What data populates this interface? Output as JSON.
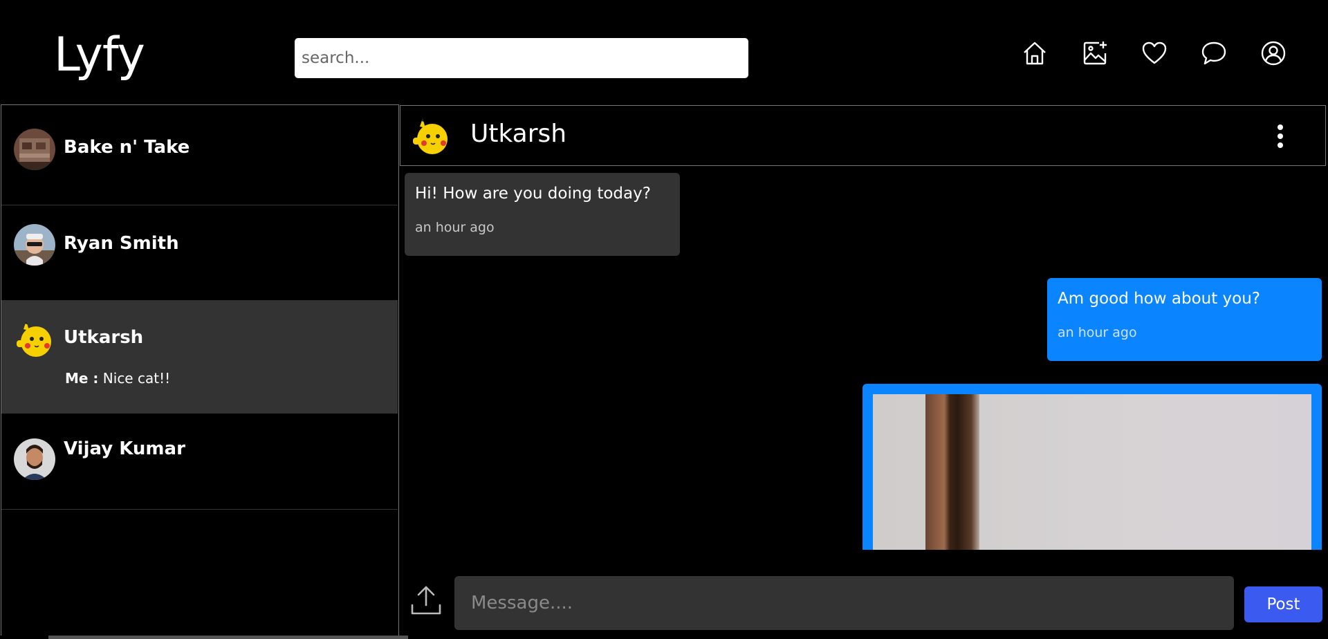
{
  "header": {
    "logo": "Lyfy",
    "search_placeholder": "search...",
    "nav_icons": [
      "home-icon",
      "add-photo-icon",
      "heart-icon",
      "chat-icon",
      "profile-icon"
    ]
  },
  "sidebar": {
    "contacts": [
      {
        "name": "Bake n' Take",
        "preview_sender": "",
        "preview_text": ""
      },
      {
        "name": "Ryan Smith",
        "preview_sender": "",
        "preview_text": ""
      },
      {
        "name": "Utkarsh",
        "preview_sender": "Me :",
        "preview_text": "Nice cat!!"
      },
      {
        "name": "Vijay Kumar",
        "preview_sender": "",
        "preview_text": ""
      }
    ]
  },
  "chat": {
    "contact_name": "Utkarsh",
    "messages": [
      {
        "direction": "in",
        "text": "Hi! How are you doing today?",
        "time": "an hour ago"
      },
      {
        "direction": "out",
        "text": "Am good how about you?",
        "time": "an hour ago"
      }
    ],
    "input_placeholder": "Message....",
    "post_label": "Post"
  },
  "colors": {
    "background": "#000000",
    "outgoing_bubble": "#0a84ff",
    "incoming_bubble": "#333333",
    "post_button": "#3b5bf0",
    "active_contact": "#333333"
  }
}
